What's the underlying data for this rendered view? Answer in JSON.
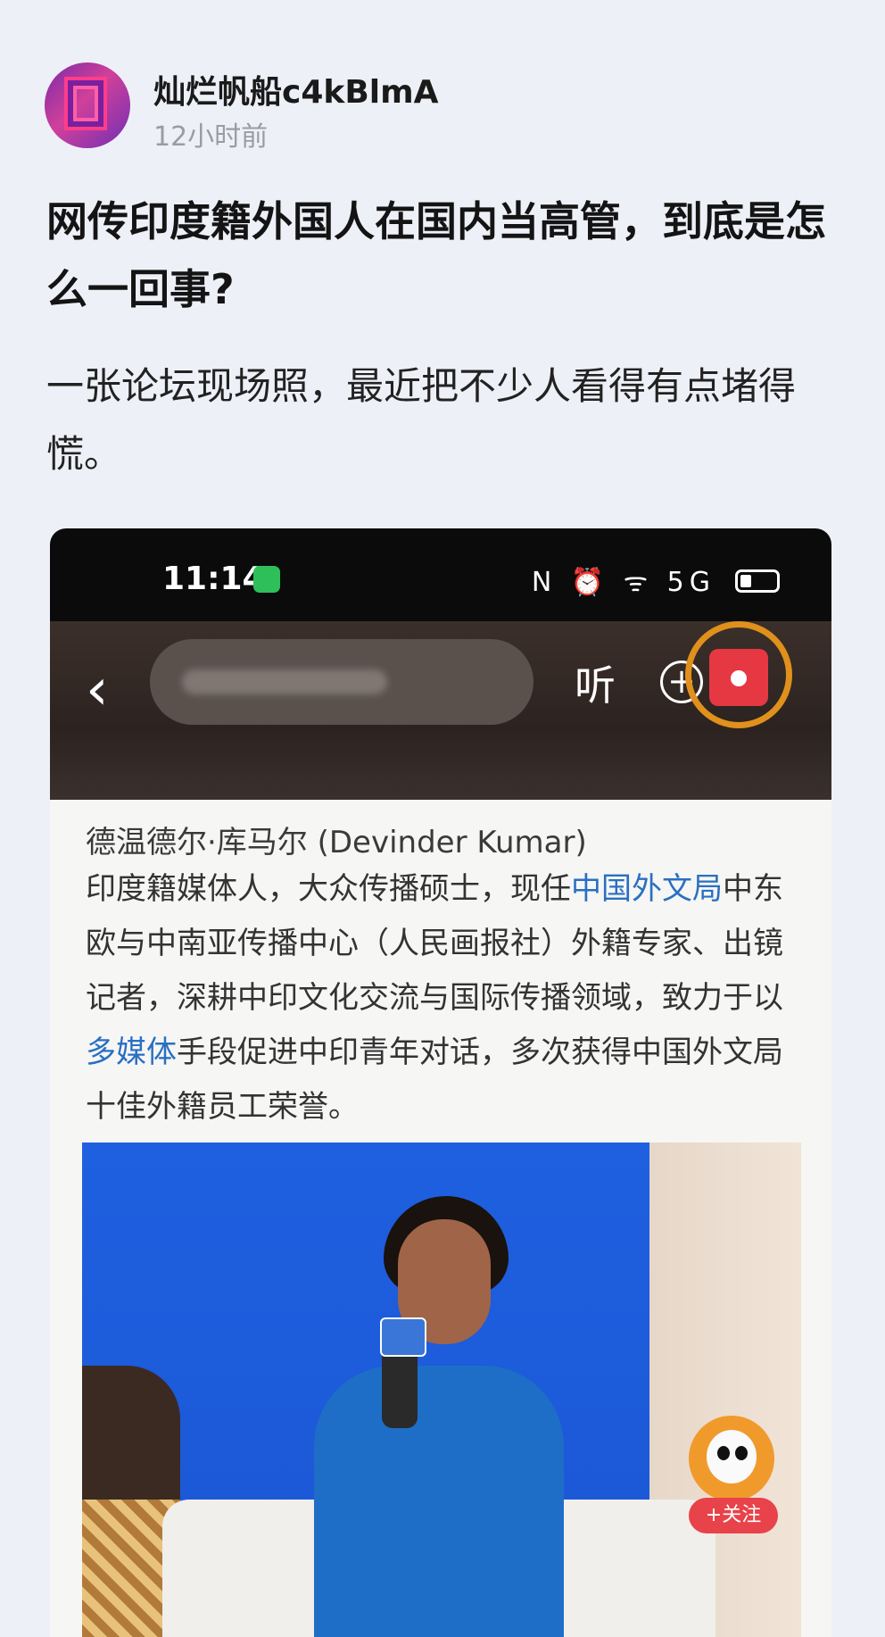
{
  "author": {
    "name": "灿烂帆船c4kBlmA",
    "time": "12小时前",
    "avatar_icon": "abstract-neon-corridor-avatar"
  },
  "post": {
    "title": "网传印度籍外国人在国内当高管，到底是怎么一回事?",
    "body": "一张论坛现场照，最近把不少人看得有点堵得慌。"
  },
  "screenshot": {
    "status_bar": {
      "time": "11:14",
      "icons": "N ⏰ ᯤ 5G"
    },
    "nav": {
      "back_icon": "chevron-left-icon",
      "listen_label": "听",
      "plus_icon": "plus-circle-icon",
      "red_packet_icon": "red-envelope-icon"
    },
    "article": {
      "heading": "德温德尔·库马尔 (Devinder Kumar)",
      "bio_part1": "印度籍媒体人，大众传播硕士，现任",
      "bio_link1": "中国外文局",
      "bio_part2": "中东欧与中南亚传播中心（人民画报社）外籍专家、出镜记者，深耕中印文化交流与国际传播领域，致力于以",
      "bio_link2": "多媒体",
      "bio_part3": "手段促进中印青年对话，多次获得中国外文局十佳外籍员工荣誉。"
    },
    "follow": {
      "label": "+关注",
      "avatar_icon": "panda-avatar"
    }
  },
  "colors": {
    "background": "#eef0f7",
    "link": "#2a6fc2",
    "follow_button": "#e8424a",
    "red_packet_ring": "#e0901c"
  }
}
